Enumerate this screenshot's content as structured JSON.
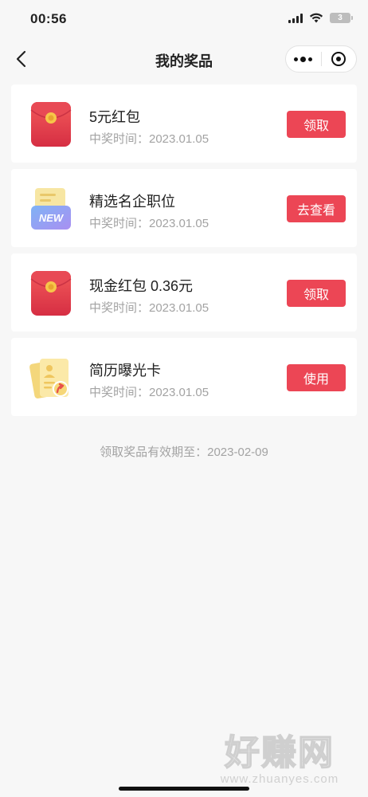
{
  "status_bar": {
    "time": "00:56",
    "battery": "3"
  },
  "nav": {
    "title": "我的奖品"
  },
  "prizes": [
    {
      "name": "5元红包",
      "time": "中奖时间：2023.01.05",
      "action": "领取",
      "icon": "red-envelope-icon"
    },
    {
      "name": "精选名企职位",
      "time": "中奖时间：2023.01.05",
      "action": "去查看",
      "icon": "new-folder-icon",
      "icon_text": "NEW"
    },
    {
      "name": "现金红包 0.36元",
      "time": "中奖时间：2023.01.05",
      "action": "领取",
      "icon": "red-envelope-icon"
    },
    {
      "name": "简历曝光卡",
      "time": "中奖时间：2023.01.05",
      "action": "使用",
      "icon": "resume-card-icon"
    }
  ],
  "footer": {
    "expiry": "领取奖品有效期至：2023-02-09"
  },
  "watermark": {
    "main": "好赚网",
    "sub": "www.zhuanyes.com"
  },
  "colors": {
    "accent": "#ec4655",
    "background": "#f7f7f7"
  }
}
